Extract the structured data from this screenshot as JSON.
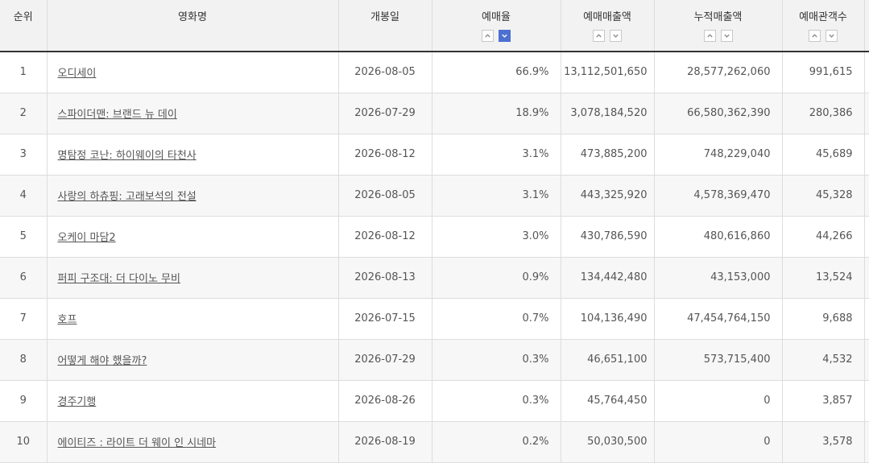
{
  "headers": {
    "rank": "순위",
    "title": "영화명",
    "release": "개봉일",
    "rate": "예매율",
    "sales": "예매매출액",
    "cum_sales": "누적매출액",
    "audience": "예매관객수"
  },
  "sort_active": {
    "rate": "desc"
  },
  "accent_color": "#4c6fd1",
  "rows": [
    {
      "rank": "1",
      "title": "오디세이",
      "release": "2026-08-05",
      "rate": "66.9%",
      "sales": "13,112,501,650",
      "cum_sales": "28,577,262,060",
      "audience": "991,615"
    },
    {
      "rank": "2",
      "title": "스파이더맨: 브랜드 뉴 데이",
      "release": "2026-07-29",
      "rate": "18.9%",
      "sales": "3,078,184,520",
      "cum_sales": "66,580,362,390",
      "audience": "280,386"
    },
    {
      "rank": "3",
      "title": "명탐정 코난: 하이웨이의 타천사",
      "release": "2026-08-12",
      "rate": "3.1%",
      "sales": "473,885,200",
      "cum_sales": "748,229,040",
      "audience": "45,689"
    },
    {
      "rank": "4",
      "title": "사랑의 하츄핑: 고래보석의 전설",
      "release": "2026-08-05",
      "rate": "3.1%",
      "sales": "443,325,920",
      "cum_sales": "4,578,369,470",
      "audience": "45,328"
    },
    {
      "rank": "5",
      "title": "오케이 마담2",
      "release": "2026-08-12",
      "rate": "3.0%",
      "sales": "430,786,590",
      "cum_sales": "480,616,860",
      "audience": "44,266"
    },
    {
      "rank": "6",
      "title": "퍼피 구조대: 더 다이노 무비",
      "release": "2026-08-13",
      "rate": "0.9%",
      "sales": "134,442,480",
      "cum_sales": "43,153,000",
      "audience": "13,524"
    },
    {
      "rank": "7",
      "title": "호프",
      "release": "2026-07-15",
      "rate": "0.7%",
      "sales": "104,136,490",
      "cum_sales": "47,454,764,150",
      "audience": "9,688"
    },
    {
      "rank": "8",
      "title": "어떻게 해야 했을까?",
      "release": "2026-07-29",
      "rate": "0.3%",
      "sales": "46,651,100",
      "cum_sales": "573,715,400",
      "audience": "4,532"
    },
    {
      "rank": "9",
      "title": "경주기행",
      "release": "2026-08-26",
      "rate": "0.3%",
      "sales": "45,764,450",
      "cum_sales": "0",
      "audience": "3,857"
    },
    {
      "rank": "10",
      "title": "에이티즈 : 라이트 더 웨이 인 시네마",
      "release": "2026-08-19",
      "rate": "0.2%",
      "sales": "50,030,500",
      "cum_sales": "0",
      "audience": "3,578"
    }
  ]
}
